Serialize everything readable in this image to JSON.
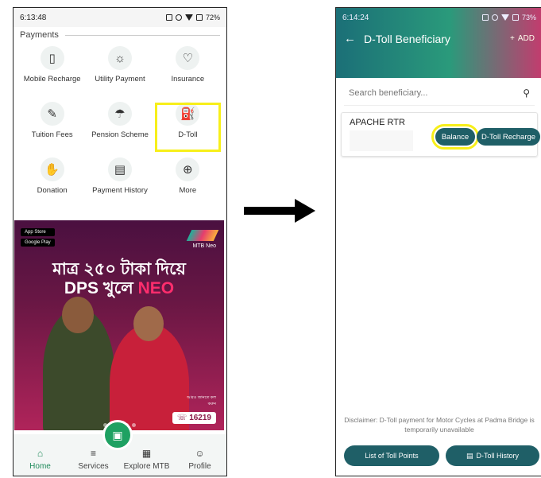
{
  "left": {
    "status": {
      "time": "6:13:48",
      "battery": "72%"
    },
    "section_title": "Payments",
    "tiles": [
      {
        "label": "Mobile Recharge",
        "icon": "mobile-recharge-icon",
        "glyph": "▯"
      },
      {
        "label": "Utility Payment",
        "icon": "utility-payment-icon",
        "glyph": "☼"
      },
      {
        "label": "Insurance",
        "icon": "insurance-icon",
        "glyph": "♡"
      },
      {
        "label": "Tuition Fees",
        "icon": "tuition-fees-icon",
        "glyph": "✎"
      },
      {
        "label": "Pension Scheme",
        "icon": "pension-scheme-icon",
        "glyph": "☂"
      },
      {
        "label": "D-Toll",
        "icon": "d-toll-icon",
        "glyph": "⛽"
      },
      {
        "label": "Donation",
        "icon": "donation-icon",
        "glyph": "✋"
      },
      {
        "label": "Payment History",
        "icon": "payment-history-icon",
        "glyph": "▤"
      },
      {
        "label": "More",
        "icon": "more-icon",
        "glyph": "⊕"
      }
    ],
    "banner": {
      "app_store": "App Store",
      "google_play": "Google Play",
      "brand": "MTB Neo",
      "headline_line1": "মাত্র ২৫০ টাকা দিয়ে",
      "headline_line2": "DPS খুলে ",
      "headline_neo": "NEO",
      "small_text": "আরও জানতে কল করুন",
      "hotline": "16219"
    },
    "nav": [
      {
        "label": "Home",
        "icon": "home-icon",
        "glyph": "⌂"
      },
      {
        "label": "Services",
        "icon": "services-icon",
        "glyph": "≡"
      },
      {
        "label": "Explore MTB",
        "icon": "explore-icon",
        "glyph": "▦"
      },
      {
        "label": "Profile",
        "icon": "profile-icon",
        "glyph": "☺"
      }
    ],
    "highlight_color": "#f7ef1a",
    "accent": "#1ea162"
  },
  "right": {
    "status": {
      "time": "6:14:24",
      "battery": "73%"
    },
    "title": "D-Toll Beneficiary",
    "add_label": "ADD",
    "search_placeholder": "Search beneficiary...",
    "beneficiary": {
      "name": "APACHE RTR"
    },
    "balance_label": "Balance",
    "recharge_label": "D-Toll Recharge",
    "disclaimer": "Disclaimer: D-Toll payment for Motor Cycles at Padma Bridge is temporarily unavailable",
    "toll_points_label": "List of Toll Points",
    "toll_history_label": "D-Toll History",
    "button_color": "#1f5f67"
  }
}
